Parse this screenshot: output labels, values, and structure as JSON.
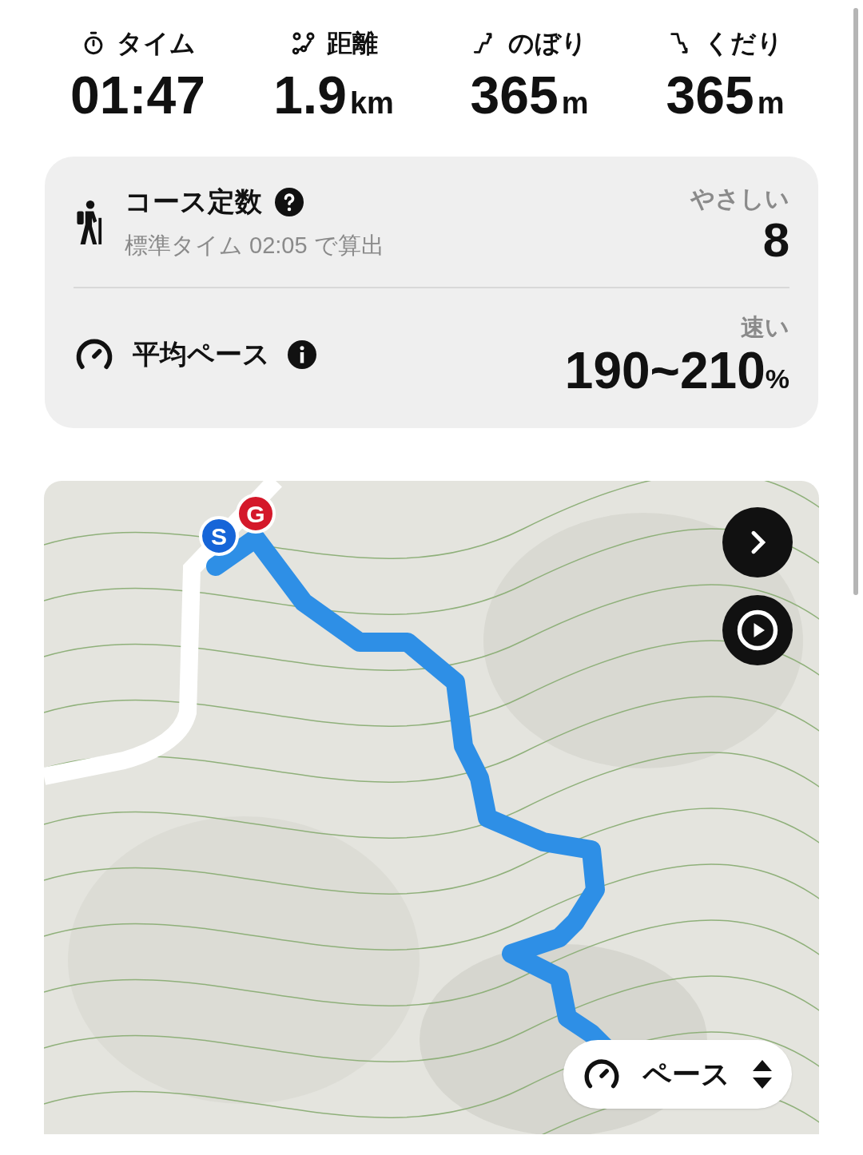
{
  "stats": [
    {
      "kind": "time",
      "label": "タイム",
      "value": "01:47"
    },
    {
      "kind": "distance",
      "label": "距離",
      "value": "1.9",
      "unit": "km"
    },
    {
      "kind": "up",
      "label": "のぼり",
      "value": "365",
      "unit": "m"
    },
    {
      "kind": "down",
      "label": "くだり",
      "value": "365",
      "unit": "m"
    }
  ],
  "course": {
    "title": "コース定数",
    "note": "標準タイム 02:05 で算出",
    "rating": "やさしい",
    "value": "8"
  },
  "pace": {
    "title": "平均ペース",
    "rating": "速い",
    "value": "190~210",
    "unit": "%"
  },
  "map": {
    "start_marker": "S",
    "goal_marker": "G",
    "pace_button": "ペース"
  }
}
